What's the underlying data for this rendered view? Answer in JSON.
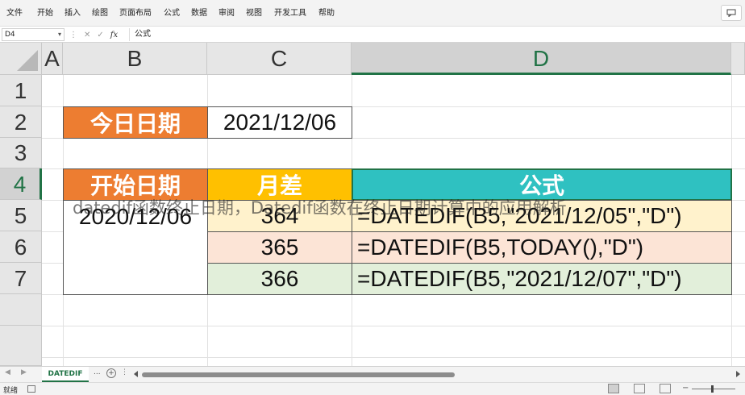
{
  "ribbon": {
    "tabs": [
      "文件",
      "开始",
      "插入",
      "绘图",
      "页面布局",
      "公式",
      "数据",
      "审阅",
      "视图",
      "开发工具",
      "帮助"
    ],
    "share_icon": "comment-icon"
  },
  "formula_bar": {
    "name_box": "D4",
    "fx": "fx",
    "value": "公式"
  },
  "columns": [
    "A",
    "B",
    "C",
    "D"
  ],
  "rows": [
    "1",
    "2",
    "3",
    "4",
    "5",
    "6",
    "7"
  ],
  "cells": {
    "b2": "今日日期",
    "c2": "2021/12/06",
    "b4": "开始日期",
    "c4": "月差",
    "d4": "公式",
    "b5": "2020/12/06",
    "c5": "364",
    "d5": "=DATEDIF(B5,\"2021/12/05\",\"D\")",
    "c6": "365",
    "d6": "=DATEDIF(B5,TODAY(),\"D\")",
    "c7": "366",
    "d7": "=DATEDIF(B5,\"2021/12/07\",\"D\")"
  },
  "colors": {
    "orange": "#ED7D31",
    "yellow": "#FFC000",
    "teal": "#2FC1C1",
    "row5_fill": "#FFF2CC",
    "row6_fill": "#FCE4D6",
    "row7_fill": "#E2EFDA",
    "excel_green": "#217346"
  },
  "watermark": "datedif函数终止日期，Datedif函数在终止日期计算中的应用解析",
  "sheet_tabs": {
    "active": "DATEDIF",
    "more": "..."
  },
  "status": {
    "ready": "就绪"
  }
}
